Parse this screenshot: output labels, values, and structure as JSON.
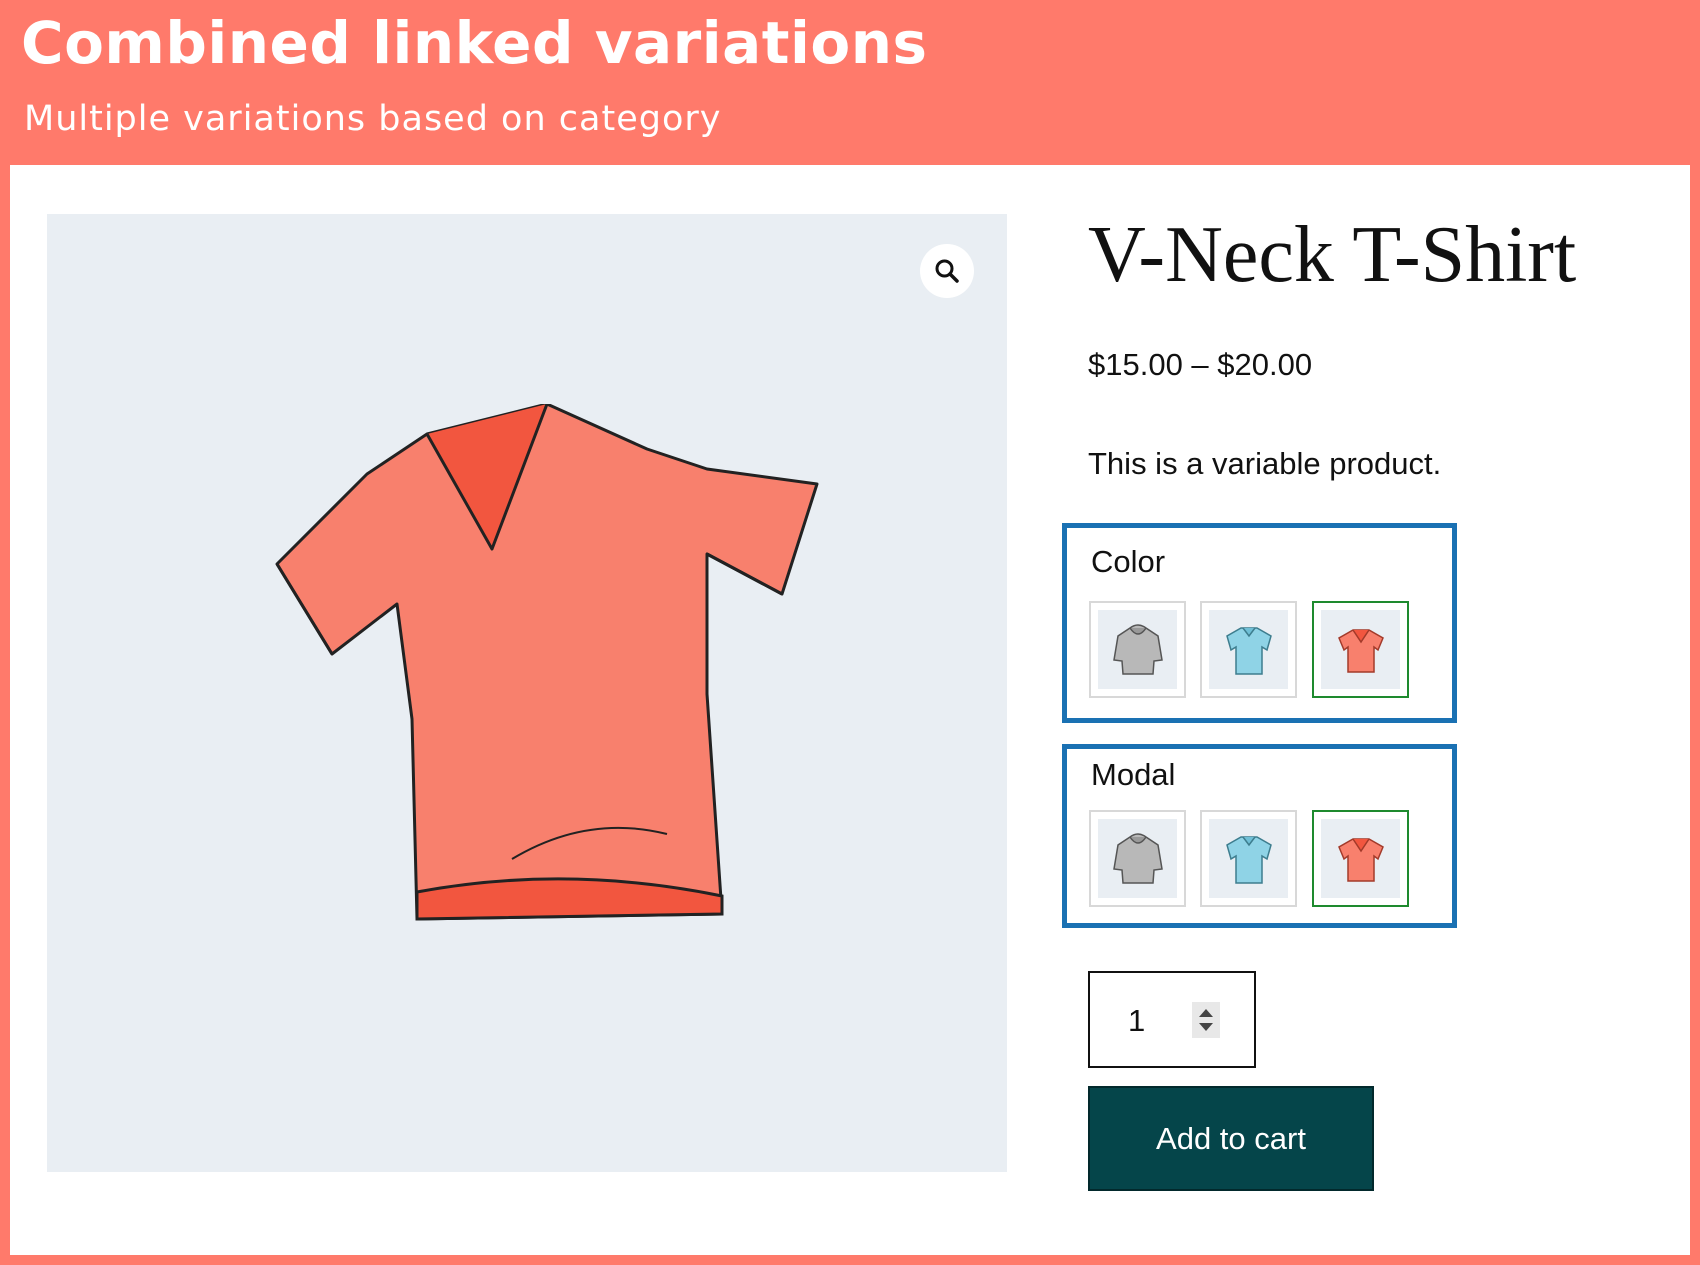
{
  "banner": {
    "title": "Combined linked variations",
    "subtitle": "Multiple variations based on category"
  },
  "product": {
    "title": "V-Neck T-Shirt",
    "price": "$15.00 – $20.00",
    "description": "This is a variable product."
  },
  "attributes": [
    {
      "label": "Color",
      "options": [
        {
          "icon": "hoodie-icon",
          "color": "#b8b8b8",
          "selected": false
        },
        {
          "icon": "polo-shirt-icon",
          "color": "#8fd3e6",
          "selected": false
        },
        {
          "icon": "vneck-tshirt-icon",
          "color": "#f8806d",
          "selected": true
        }
      ]
    },
    {
      "label": "Modal",
      "options": [
        {
          "icon": "hoodie-icon",
          "color": "#b8b8b8",
          "selected": false
        },
        {
          "icon": "polo-shirt-icon",
          "color": "#8fd3e6",
          "selected": false
        },
        {
          "icon": "vneck-tshirt-icon",
          "color": "#f8806d",
          "selected": true
        }
      ]
    }
  ],
  "quantity": {
    "value": "1"
  },
  "cart": {
    "label": "Add to cart"
  },
  "colors": {
    "banner": "#ff7a6b",
    "attribute_border": "#1a71b3",
    "selected_border": "#1e8a2e",
    "button": "#05454a",
    "gallery_bg": "#e9eef3"
  },
  "icons": {
    "zoom": "magnifier-icon",
    "stepper": "up-down-arrows-icon"
  }
}
